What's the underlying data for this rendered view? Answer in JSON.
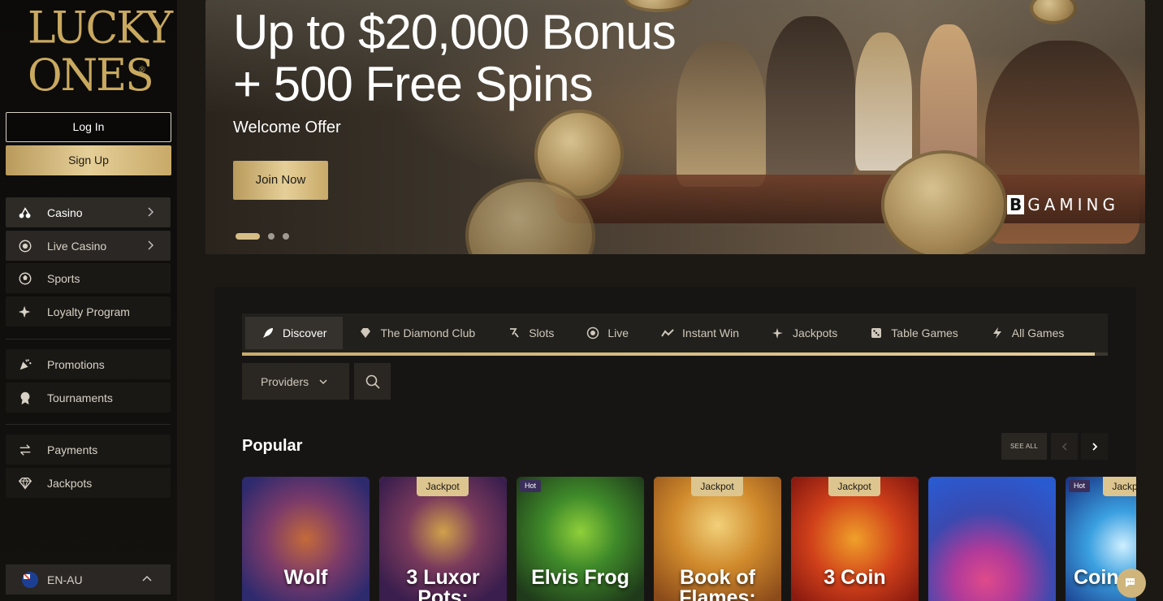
{
  "sidebar": {
    "logo": {
      "line1": "LUCKY",
      "line2": "ONES",
      "reg": "®"
    },
    "login_label": "Log In",
    "signup_label": "Sign Up",
    "nav": [
      {
        "label": "Casino",
        "icon": "cherries-icon"
      },
      {
        "label": "Live Casino",
        "icon": "chip-icon"
      },
      {
        "label": "Sports",
        "icon": "ball-icon"
      },
      {
        "label": "Loyalty Program",
        "icon": "sparkle-icon"
      },
      {
        "label": "Promotions",
        "icon": "party-popper-icon"
      },
      {
        "label": "Tournaments",
        "icon": "medal-icon"
      },
      {
        "label": "Payments",
        "icon": "arrows-exchange-icon"
      },
      {
        "label": "Jackpots",
        "icon": "diamond-icon"
      }
    ],
    "language": "EN-AU"
  },
  "hero": {
    "title_line1": "Up to $20,000 Bonus",
    "title_line2": "+ 500 Free Spins",
    "subtitle": "Welcome Offer",
    "cta": "Join Now",
    "brand_b": "B",
    "brand_rest": "GAMING",
    "slide_count": 3,
    "active_slide": 1
  },
  "games": {
    "tabs": [
      {
        "label": "Discover",
        "icon": "rocket-icon"
      },
      {
        "label": "The Diamond Club",
        "icon": "diamond-icon"
      },
      {
        "label": "Slots",
        "icon": "slot-icon"
      },
      {
        "label": "Live",
        "icon": "chip-icon"
      },
      {
        "label": "Instant Win",
        "icon": "trend-icon"
      },
      {
        "label": "Jackpots",
        "icon": "sparkle-icon"
      },
      {
        "label": "Table Games",
        "icon": "dice-icon"
      },
      {
        "label": "All Games",
        "icon": "lightning-icon"
      }
    ],
    "providers_label": "Providers",
    "section_title": "Popular",
    "see_all": "SEE ALL",
    "cards": [
      {
        "name": "Wolf",
        "badge": ""
      },
      {
        "name": "3 Luxor Pots:",
        "badge": "Jackpot"
      },
      {
        "name": "Elvis Frog",
        "badge": "Hot"
      },
      {
        "name": "Book of Flames:",
        "badge": "Jackpot"
      },
      {
        "name": "3 Coin",
        "badge": "Jackpot"
      },
      {
        "name": "",
        "badge": ""
      },
      {
        "name": "Coin",
        "badge": "Hot",
        "badge2": "Jackpot"
      }
    ]
  },
  "colors": {
    "gold": "#d5bd85",
    "bg": "#1c1915",
    "sidebar": "#0c0b0a"
  }
}
